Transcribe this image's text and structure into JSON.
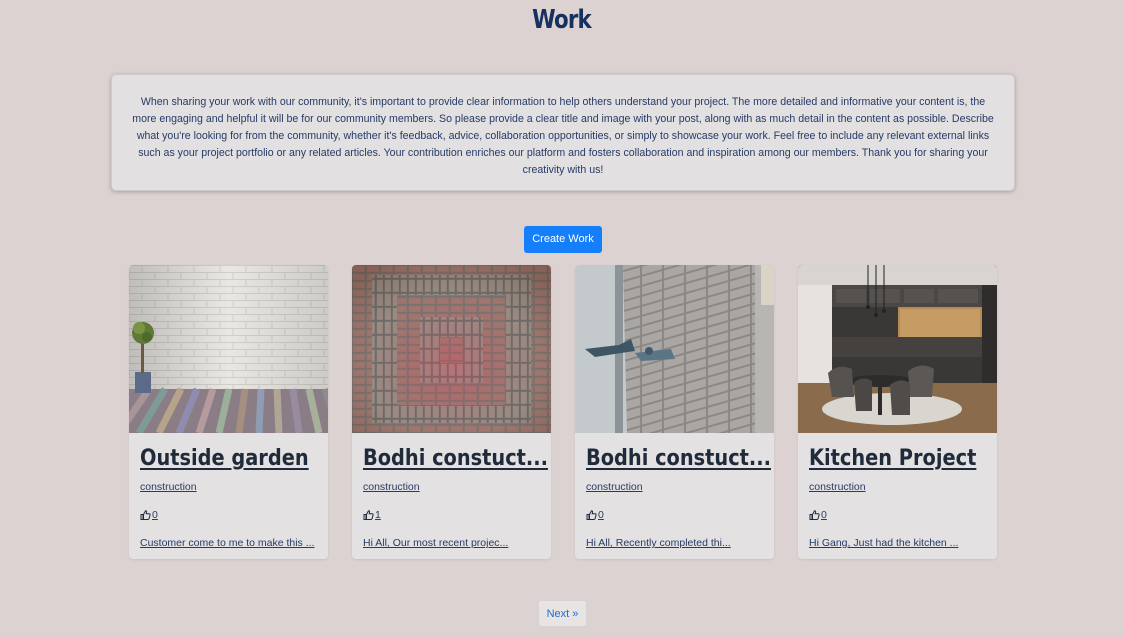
{
  "page": {
    "title": "Work",
    "intro": "When sharing your work with our community, it's important to provide clear information to help others understand your project. The more detailed and informative your content is, the more engaging and helpful it will be for our community members. So please provide a clear title and image with your post, along with as much detail in the content as possible. Describe what you're looking for from the community, whether it's feedback, advice, collaboration opportunities, or simply to showcase your work. Feel free to include any relevant external links such as your project portfolio or any related articles. Your contribution enriches our platform and fosters collaboration and inspiration among our members. Thank you for sharing your creativity with us!",
    "create_button": "Create Work",
    "next_button": "Next »"
  },
  "cards": [
    {
      "title": "Outside garden",
      "category": "construction",
      "likes": "0",
      "description": "Customer come to me to make this ...",
      "image": "white-brick-wall-potted-plant-photo"
    },
    {
      "title": "Bodhi constuct...",
      "category": "construction",
      "likes": "1",
      "description": "Hi All, Our most recent projec...",
      "image": "brick-paving-pattern-photo"
    },
    {
      "title": "Bodhi constuct...",
      "category": "construction",
      "likes": "0",
      "description": "Hi All, Recently completed thi...",
      "image": "grey-brick-wall-construction-photo"
    },
    {
      "title": "Kitchen Project",
      "category": "construction",
      "likes": "0",
      "description": "Hi Gang, Just had the kitchen ...",
      "image": "modern-kitchen-dining-photo"
    }
  ],
  "colors": {
    "background": "#dcd2d2",
    "accent": "#157efb",
    "title": "#16305f"
  }
}
